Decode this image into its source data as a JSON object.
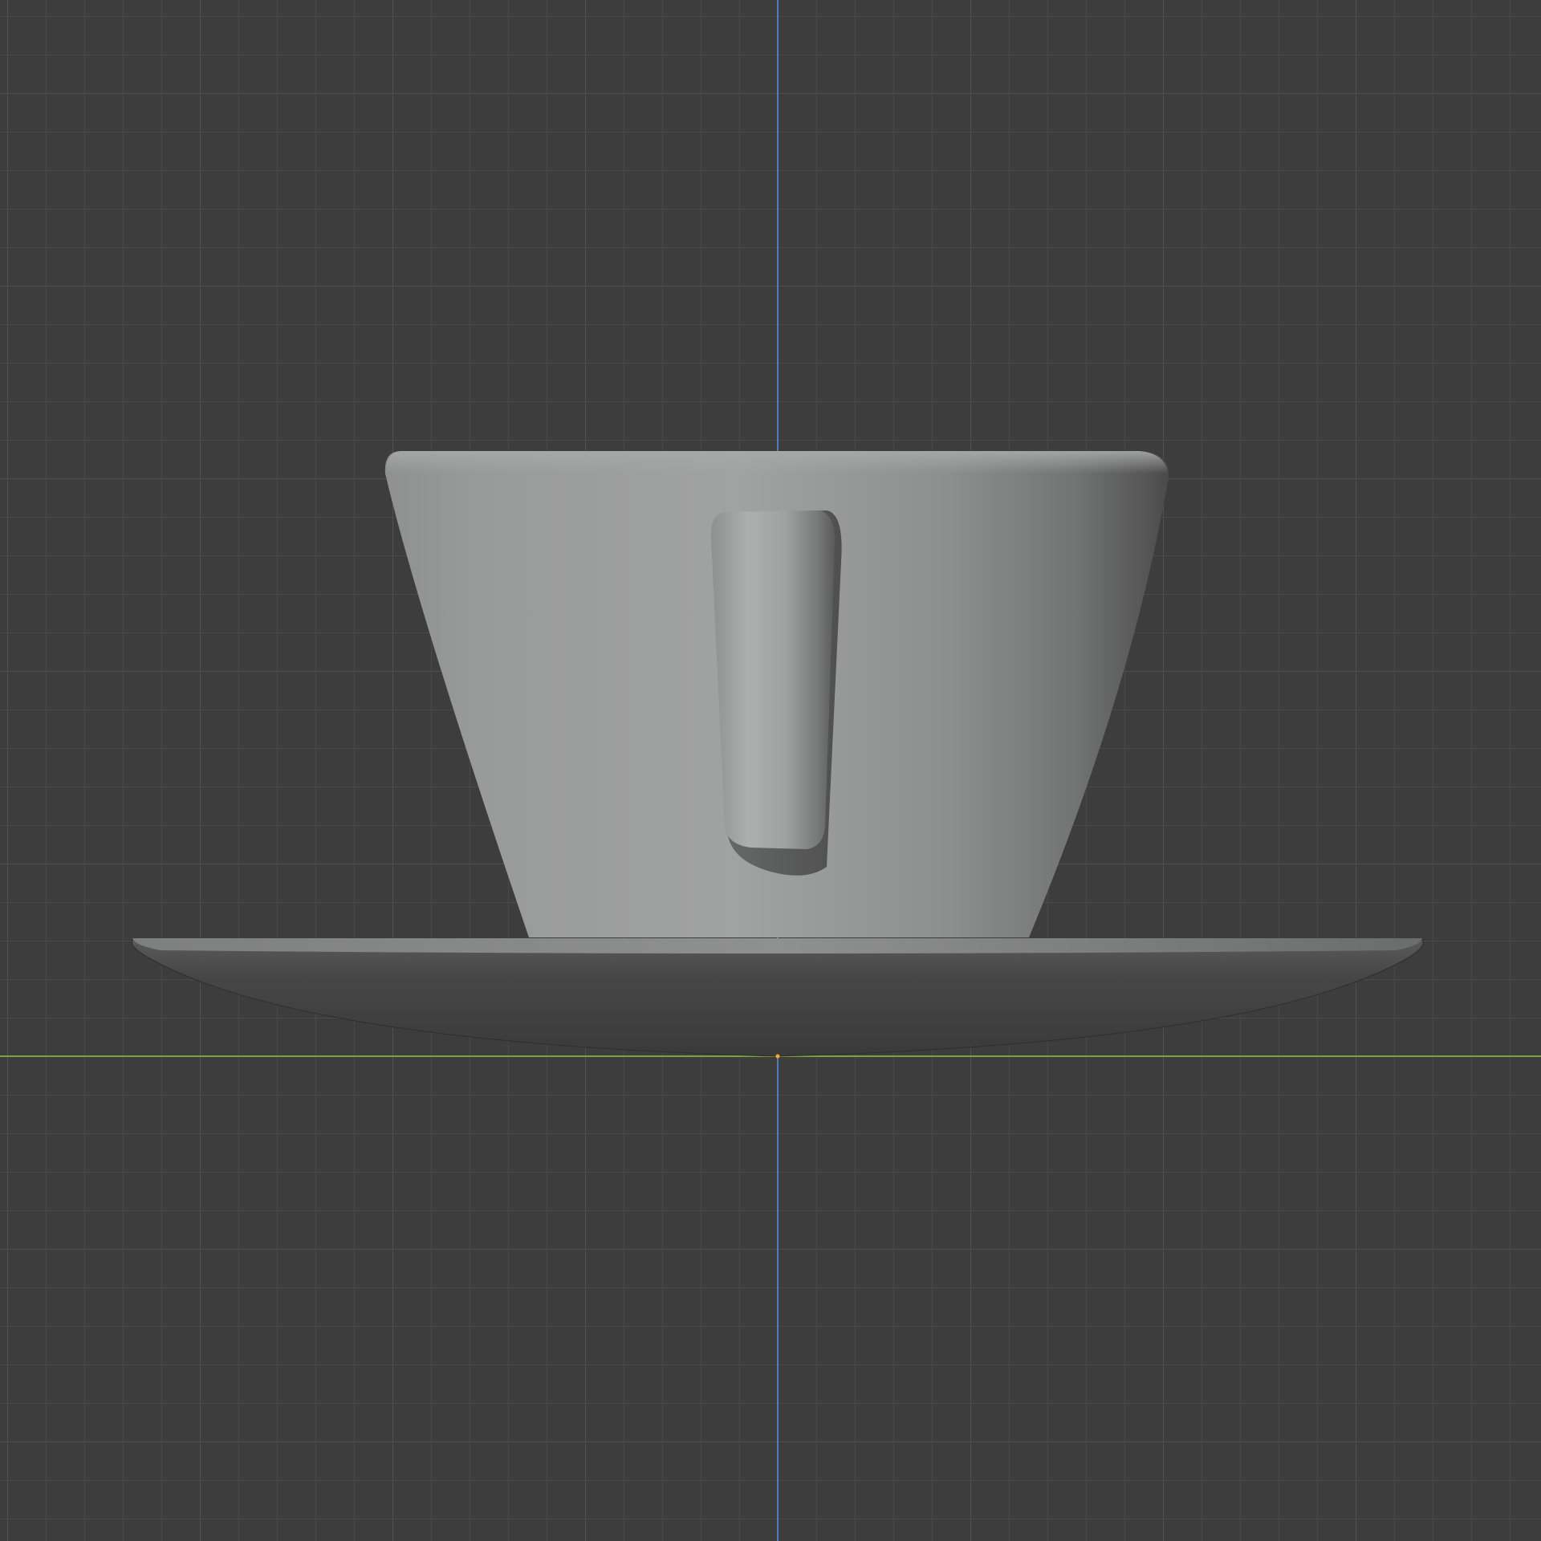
{
  "viewport": {
    "mode": "3d-viewport-front-orthographic",
    "background_color": "#3d3d3d",
    "grid_color": "#4a4a4a",
    "grid_major_color": "#505050",
    "axis_vertical_color": "#4f7fb3",
    "axis_horizontal_color": "#7da23a",
    "origin_color": "#ffa733"
  },
  "scene": {
    "objects": [
      {
        "name": "cup",
        "color": "#9a9b9b"
      },
      {
        "name": "handle",
        "color": "#a3a4a4"
      },
      {
        "name": "saucer",
        "color": "#454545"
      }
    ]
  }
}
